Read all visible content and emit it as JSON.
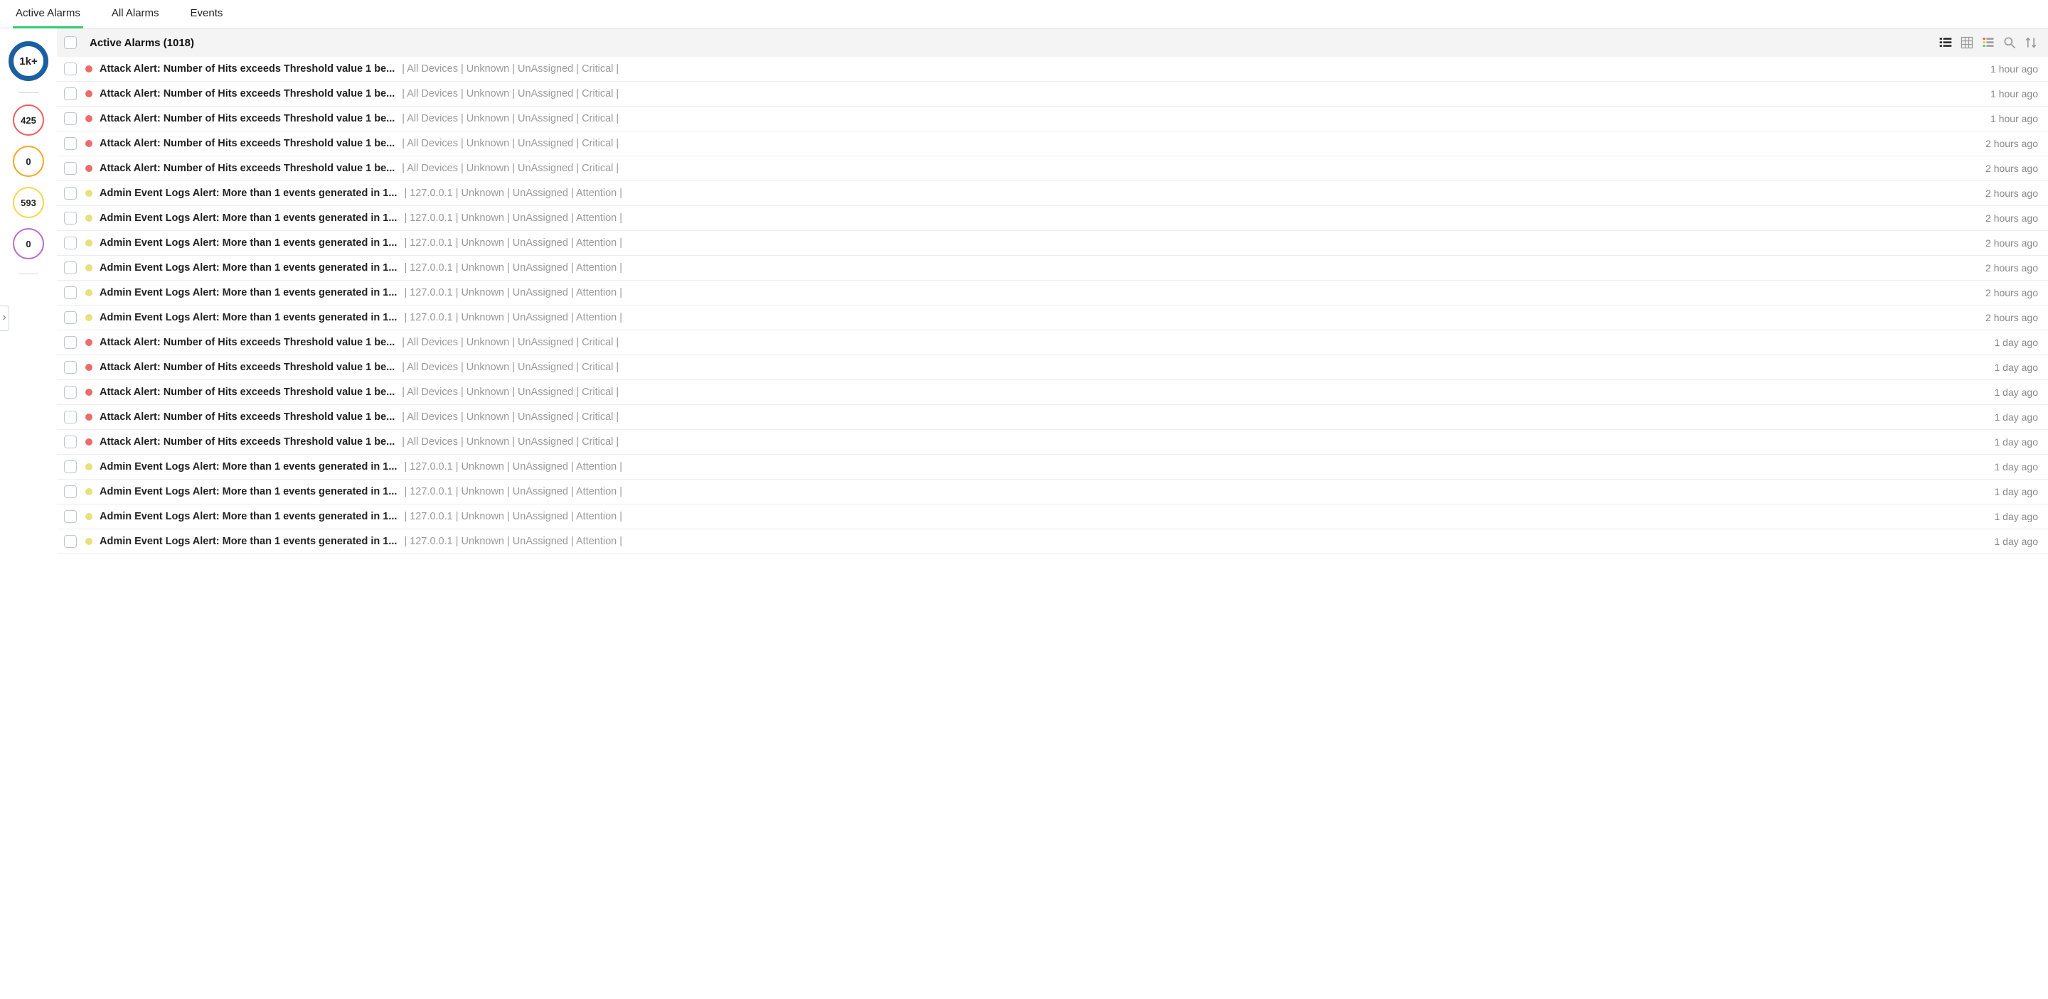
{
  "tabs": [
    {
      "label": "Active Alarms",
      "active": true
    },
    {
      "label": "All Alarms",
      "active": false
    },
    {
      "label": "Events",
      "active": false
    }
  ],
  "sidebar": {
    "total": "1k+",
    "counts": [
      {
        "value": "425",
        "cls": "sev-crit"
      },
      {
        "value": "0",
        "cls": "sev-trbl"
      },
      {
        "value": "593",
        "cls": "sev-attn"
      },
      {
        "value": "0",
        "cls": "sev-down"
      }
    ]
  },
  "header": {
    "title": "Active Alarms (1018)"
  },
  "rows": [
    {
      "sev": "critical",
      "title": "Attack Alert: Number of Hits exceeds Threshold value 1 be...",
      "meta": " | All Devices | Unknown | UnAssigned | Critical |",
      "time": "1 hour ago"
    },
    {
      "sev": "critical",
      "title": "Attack Alert: Number of Hits exceeds Threshold value 1 be...",
      "meta": " | All Devices | Unknown | UnAssigned | Critical |",
      "time": "1 hour ago"
    },
    {
      "sev": "critical",
      "title": "Attack Alert: Number of Hits exceeds Threshold value 1 be...",
      "meta": " | All Devices | Unknown | UnAssigned | Critical |",
      "time": "1 hour ago"
    },
    {
      "sev": "critical",
      "title": "Attack Alert: Number of Hits exceeds Threshold value 1 be...",
      "meta": " | All Devices | Unknown | UnAssigned | Critical |",
      "time": "2 hours ago"
    },
    {
      "sev": "critical",
      "title": "Attack Alert: Number of Hits exceeds Threshold value 1 be...",
      "meta": " | All Devices | Unknown | UnAssigned | Critical |",
      "time": "2 hours ago"
    },
    {
      "sev": "attention",
      "title": "Admin Event Logs Alert: More than 1 events generated in 1...",
      "meta": " | 127.0.0.1 | Unknown | UnAssigned | Attention |",
      "time": "2 hours ago"
    },
    {
      "sev": "attention",
      "title": "Admin Event Logs Alert: More than 1 events generated in 1...",
      "meta": " | 127.0.0.1 | Unknown | UnAssigned | Attention |",
      "time": "2 hours ago"
    },
    {
      "sev": "attention",
      "title": "Admin Event Logs Alert: More than 1 events generated in 1...",
      "meta": " | 127.0.0.1 | Unknown | UnAssigned | Attention |",
      "time": "2 hours ago"
    },
    {
      "sev": "attention",
      "title": "Admin Event Logs Alert: More than 1 events generated in 1...",
      "meta": " | 127.0.0.1 | Unknown | UnAssigned | Attention |",
      "time": "2 hours ago"
    },
    {
      "sev": "attention",
      "title": "Admin Event Logs Alert: More than 1 events generated in 1...",
      "meta": " | 127.0.0.1 | Unknown | UnAssigned | Attention |",
      "time": "2 hours ago"
    },
    {
      "sev": "attention",
      "title": "Admin Event Logs Alert: More than 1 events generated in 1...",
      "meta": " | 127.0.0.1 | Unknown | UnAssigned | Attention |",
      "time": "2 hours ago"
    },
    {
      "sev": "critical",
      "title": "Attack Alert: Number of Hits exceeds Threshold value 1 be...",
      "meta": " | All Devices | Unknown | UnAssigned | Critical |",
      "time": "1 day ago"
    },
    {
      "sev": "critical",
      "title": "Attack Alert: Number of Hits exceeds Threshold value 1 be...",
      "meta": " | All Devices | Unknown | UnAssigned | Critical |",
      "time": "1 day ago"
    },
    {
      "sev": "critical",
      "title": "Attack Alert: Number of Hits exceeds Threshold value 1 be...",
      "meta": " | All Devices | Unknown | UnAssigned | Critical |",
      "time": "1 day ago"
    },
    {
      "sev": "critical",
      "title": "Attack Alert: Number of Hits exceeds Threshold value 1 be...",
      "meta": " | All Devices | Unknown | UnAssigned | Critical |",
      "time": "1 day ago"
    },
    {
      "sev": "critical",
      "title": "Attack Alert: Number of Hits exceeds Threshold value 1 be...",
      "meta": " | All Devices | Unknown | UnAssigned | Critical |",
      "time": "1 day ago"
    },
    {
      "sev": "attention",
      "title": "Admin Event Logs Alert: More than 1 events generated in 1...",
      "meta": " | 127.0.0.1 | Unknown | UnAssigned | Attention |",
      "time": "1 day ago"
    },
    {
      "sev": "attention",
      "title": "Admin Event Logs Alert: More than 1 events generated in 1...",
      "meta": " | 127.0.0.1 | Unknown | UnAssigned | Attention |",
      "time": "1 day ago"
    },
    {
      "sev": "attention",
      "title": "Admin Event Logs Alert: More than 1 events generated in 1...",
      "meta": " | 127.0.0.1 | Unknown | UnAssigned | Attention |",
      "time": "1 day ago"
    },
    {
      "sev": "attention",
      "title": "Admin Event Logs Alert: More than 1 events generated in 1...",
      "meta": " | 127.0.0.1 | Unknown | UnAssigned | Attention |",
      "time": "1 day ago"
    }
  ]
}
